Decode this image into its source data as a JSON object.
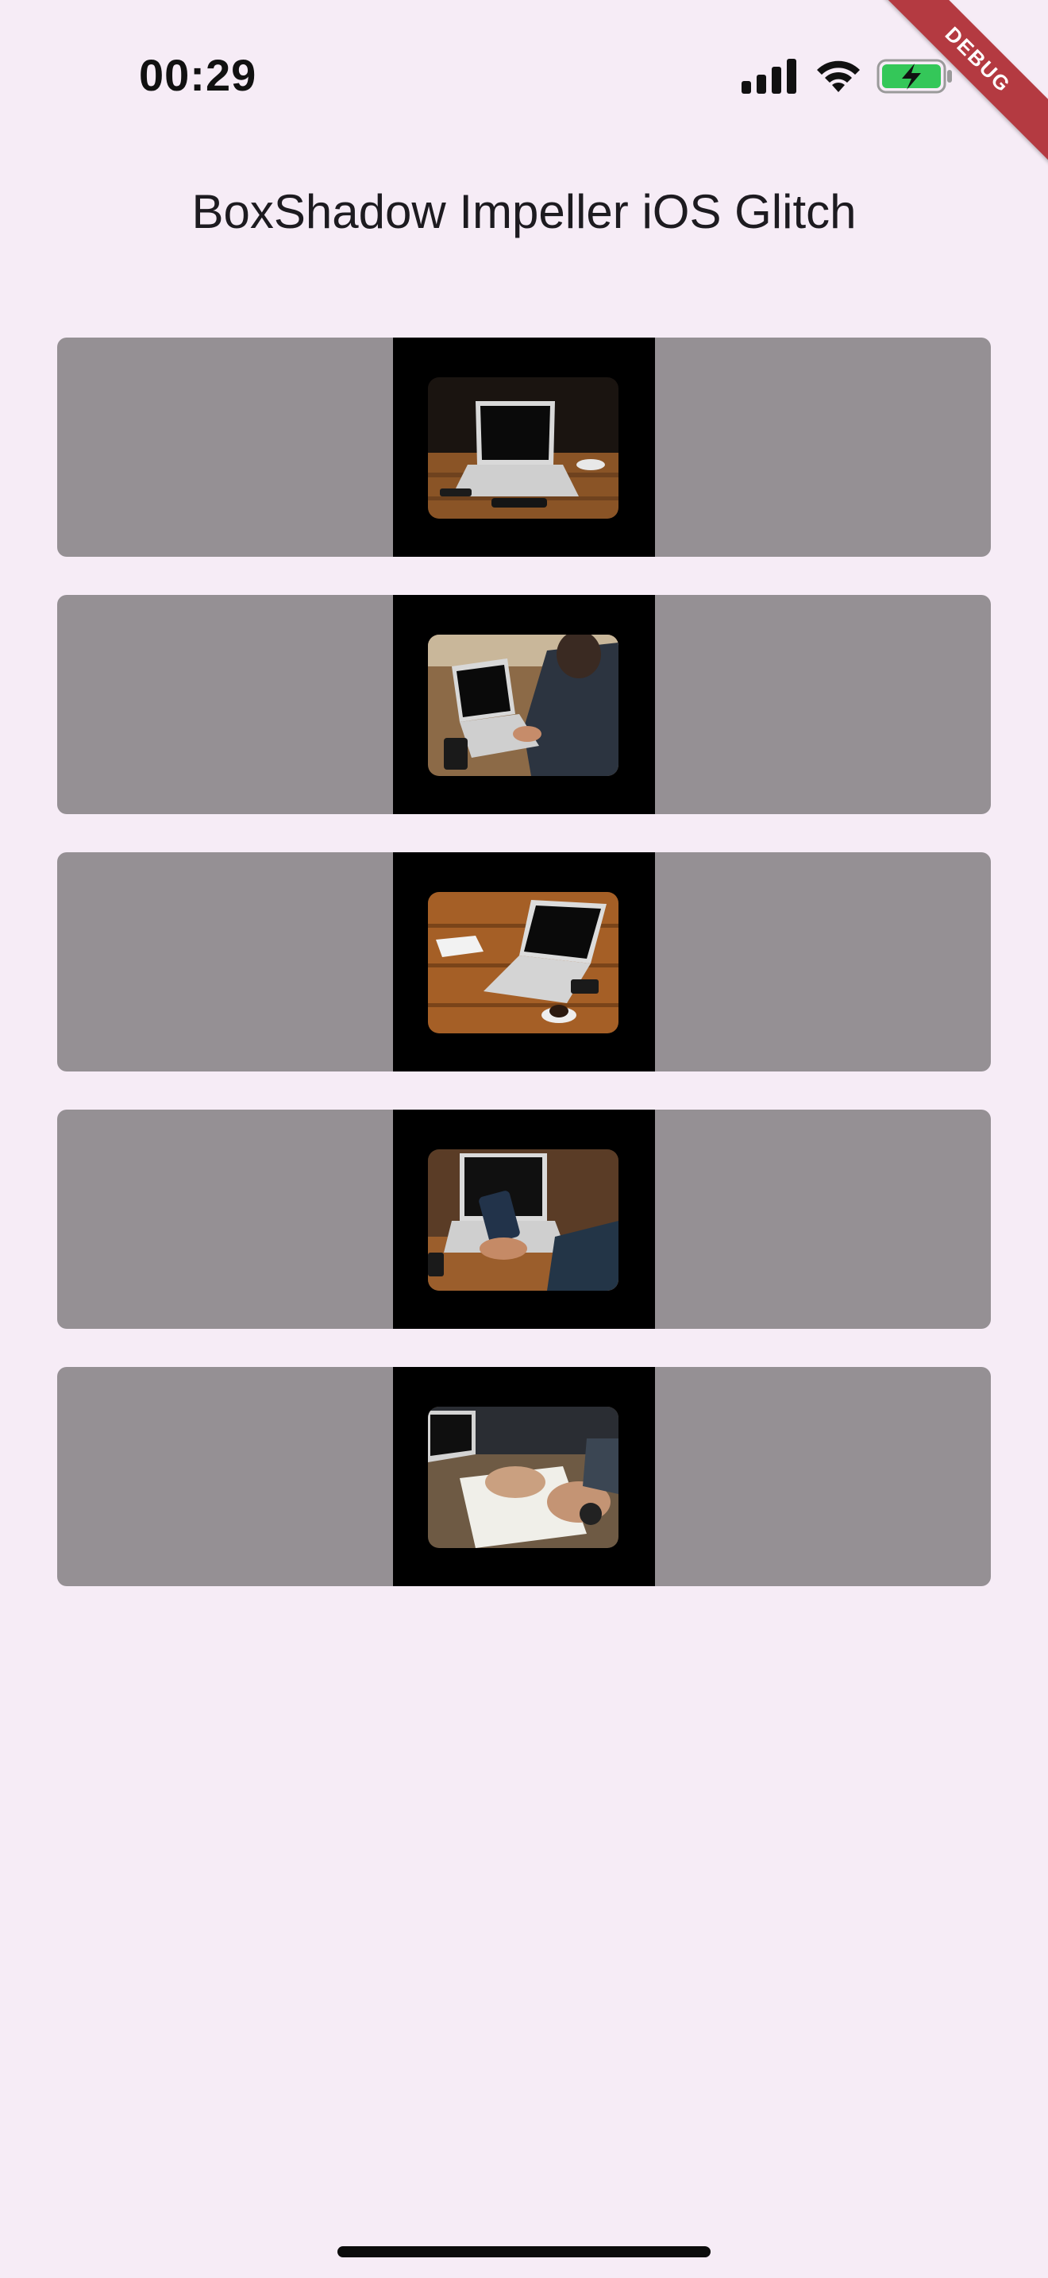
{
  "status_bar": {
    "time": "00:29",
    "icons": [
      "signal-icon",
      "wifi-icon",
      "battery-charging-icon"
    ],
    "battery_color": "#34c759"
  },
  "debug_banner": {
    "label": "DEBUG",
    "color": "#b43a41"
  },
  "app": {
    "title": "BoxShadow Impeller iOS Glitch"
  },
  "colors": {
    "background": "#f6ecf6",
    "card": "#959094",
    "card_center": "#000000"
  },
  "items": [
    {
      "image": "laptop-on-wooden-desk-photo"
    },
    {
      "image": "person-typing-on-laptop-photo"
    },
    {
      "image": "laptop-with-coffee-cup-photo"
    },
    {
      "image": "hands-holding-phone-over-laptop-photo"
    },
    {
      "image": "person-writing-in-notebook-photo"
    }
  ]
}
